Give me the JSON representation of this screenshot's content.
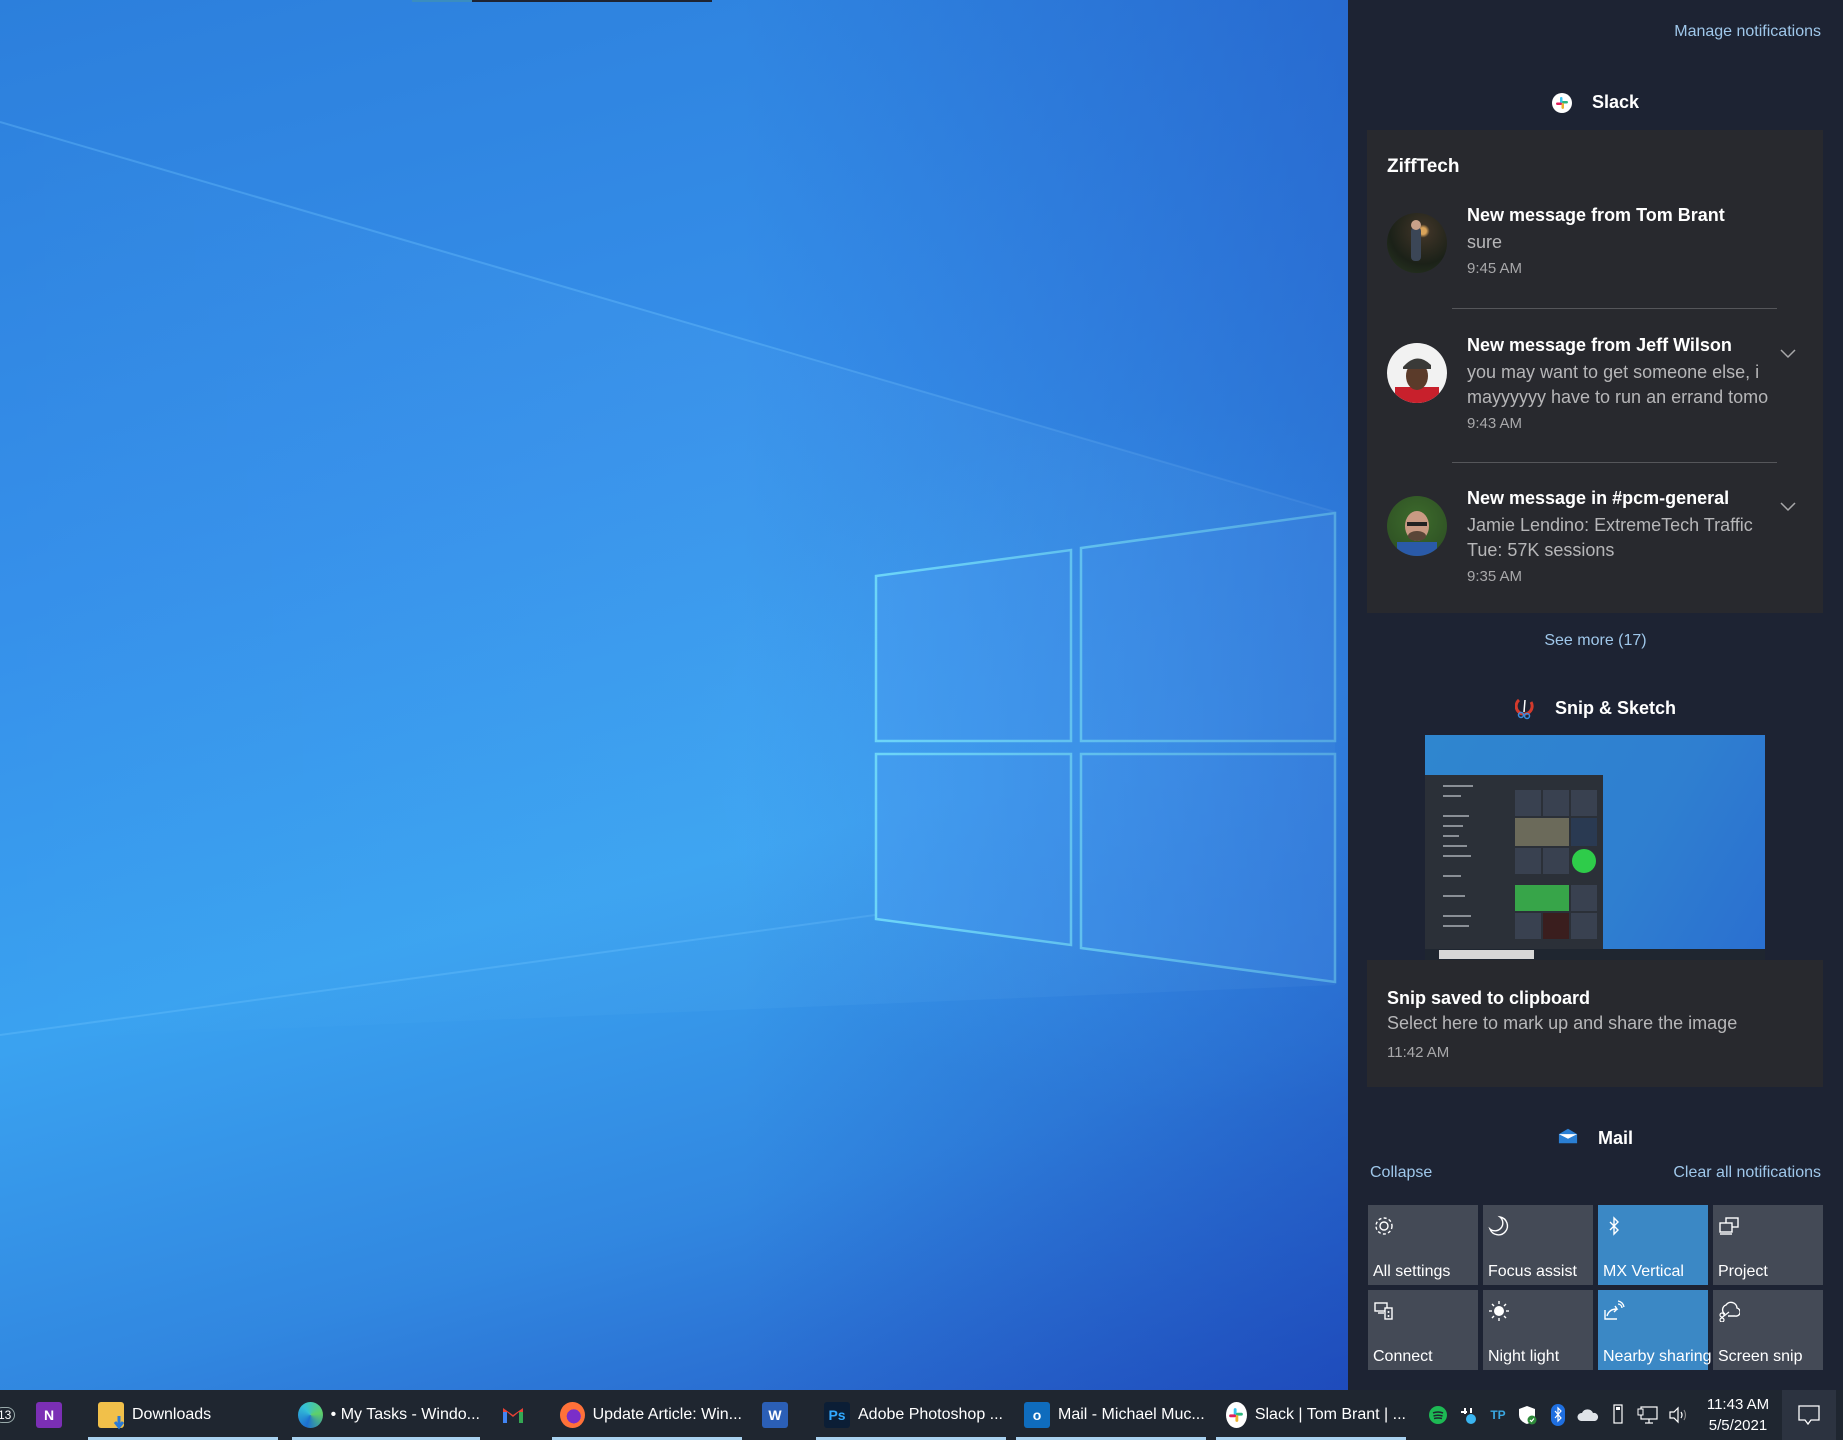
{
  "action_center": {
    "manage_notifications": "Manage notifications",
    "groups": {
      "slack": {
        "app_name": "Slack",
        "workspace": "ZiffTech",
        "messages": [
          {
            "title": "New message from Tom Brant",
            "body": "sure",
            "time": "9:45 AM",
            "expandable": false
          },
          {
            "title": "New message from Jeff Wilson",
            "body_line1": "you may want to get someone else, i",
            "body_line2": "mayyyyyy have to run an errand tomo",
            "time": "9:43 AM",
            "expandable": true
          },
          {
            "title": "New message in #pcm-general",
            "body_line1": "Jamie Lendino: ExtremeTech Traffic",
            "body_line2": "Tue: 57K sessions",
            "time": "9:35 AM",
            "expandable": true
          }
        ],
        "see_more": "See more (17)"
      },
      "snip": {
        "app_name": "Snip & Sketch",
        "title": "Snip saved to clipboard",
        "body": "Select here to mark up and share the image",
        "time": "11:42 AM"
      },
      "mail": {
        "app_name": "Mail"
      }
    },
    "collapse": "Collapse",
    "clear_all": "Clear all notifications",
    "quick_actions": [
      {
        "label": "All settings",
        "icon": "gear-icon",
        "active": false
      },
      {
        "label": "Focus assist",
        "icon": "moon-icon",
        "active": false
      },
      {
        "label": "MX Vertical",
        "icon": "bluetooth-icon",
        "active": true
      },
      {
        "label": "Project",
        "icon": "project-icon",
        "active": false
      },
      {
        "label": "Connect",
        "icon": "connect-icon",
        "active": false
      },
      {
        "label": "Night light",
        "icon": "sun-icon",
        "active": false
      },
      {
        "label": "Nearby sharing",
        "icon": "nearby-sharing-icon",
        "active": true
      },
      {
        "label": "Screen snip",
        "icon": "screen-snip-icon",
        "active": false
      }
    ]
  },
  "taskbar": {
    "badge_count": "13",
    "items": [
      {
        "label": "",
        "icon": "onenote-icon"
      },
      {
        "label": "Downloads",
        "icon": "file-explorer-icon"
      },
      {
        "label": "• My Tasks - Windo...",
        "icon": "edge-icon"
      },
      {
        "label": "",
        "icon": "gmail-icon"
      },
      {
        "label": "Update Article: Win...",
        "icon": "firefox-icon"
      },
      {
        "label": "",
        "icon": "word-icon"
      },
      {
        "label": "Adobe Photoshop ...",
        "icon": "photoshop-icon"
      },
      {
        "label": "Mail - Michael Muc...",
        "icon": "outlook-icon"
      },
      {
        "label": "Slack | Tom Brant | ...",
        "icon": "slack-icon"
      }
    ],
    "tray_tp_label": "TP",
    "clock_time": "11:43 AM",
    "clock_date": "5/5/2021"
  },
  "colors": {
    "panel_bg": "#1d2333",
    "card_bg": "#28292e",
    "tile_bg": "#444a56",
    "tile_active": "#3b88c5",
    "link": "#9fc7ea",
    "taskbar_bg": "#1f2630"
  }
}
